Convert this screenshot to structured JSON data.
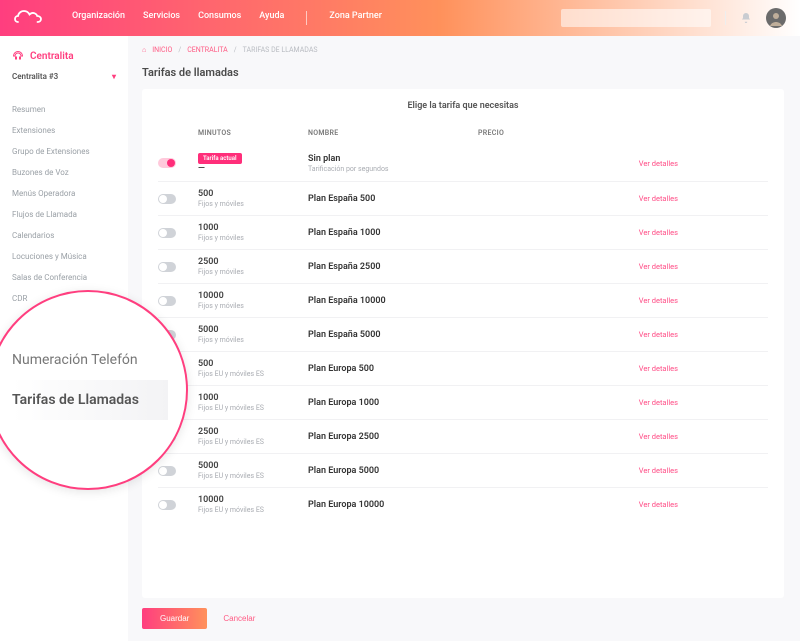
{
  "header": {
    "nav": [
      "Organización",
      "Servicios",
      "Consumos",
      "Ayuda"
    ],
    "zone": "Zona Partner"
  },
  "sidebar": {
    "title": "Centralita",
    "selector": "Centralita #3",
    "items": [
      "Resumen",
      "Extensiones",
      "Grupo de Extensiones",
      "Buzones de Voz",
      "Menús Operadora",
      "Flujos de Llamada",
      "Calendarios",
      "Locuciones y Música",
      "Salas de Conferencia",
      "CDR"
    ]
  },
  "breadcrumb": {
    "home": "INICIO",
    "mid": "CENTRALITA",
    "leaf": "TARIFAS DE LLAMADAS"
  },
  "page": {
    "title": "Tarifas de llamadas",
    "caption": "Elige la tarifa que necesitas",
    "cols": {
      "c1": "MINUTOS",
      "c2": "NOMBRE",
      "c3": "PRECIO"
    },
    "detail": "Ver detalles",
    "plans": [
      {
        "active": true,
        "badge": "Tarifa actual",
        "min": "—",
        "sub": "",
        "name": "Sin plan",
        "nsub": "Tarificación por segundos"
      },
      {
        "active": false,
        "min": "500",
        "sub": "Fijos y móviles",
        "name": "Plan España 500",
        "nsub": ""
      },
      {
        "active": false,
        "min": "1000",
        "sub": "Fijos y móviles",
        "name": "Plan España 1000",
        "nsub": ""
      },
      {
        "active": false,
        "min": "2500",
        "sub": "Fijos y móviles",
        "name": "Plan España 2500",
        "nsub": ""
      },
      {
        "active": false,
        "min": "10000",
        "sub": "Fijos y móviles",
        "name": "Plan España 10000",
        "nsub": ""
      },
      {
        "active": false,
        "min": "5000",
        "sub": "Fijos y móviles",
        "name": "Plan España 5000",
        "nsub": ""
      },
      {
        "active": false,
        "min": "500",
        "sub": "Fijos EU y móviles ES",
        "name": "Plan Europa 500",
        "nsub": ""
      },
      {
        "active": false,
        "min": "1000",
        "sub": "Fijos EU y móviles ES",
        "name": "Plan Europa 1000",
        "nsub": ""
      },
      {
        "active": false,
        "min": "2500",
        "sub": "Fijos EU y móviles ES",
        "name": "Plan Europa 2500",
        "nsub": ""
      },
      {
        "active": false,
        "min": "5000",
        "sub": "Fijos EU y móviles ES",
        "name": "Plan Europa 5000",
        "nsub": ""
      },
      {
        "active": false,
        "min": "10000",
        "sub": "Fijos EU y móviles ES",
        "name": "Plan Europa 10000",
        "nsub": ""
      }
    ]
  },
  "actions": {
    "save": "Guardar",
    "cancel": "Cancelar"
  },
  "lens": {
    "a": "Numeración Telefón",
    "b": "Tarifas de Llamadas"
  }
}
